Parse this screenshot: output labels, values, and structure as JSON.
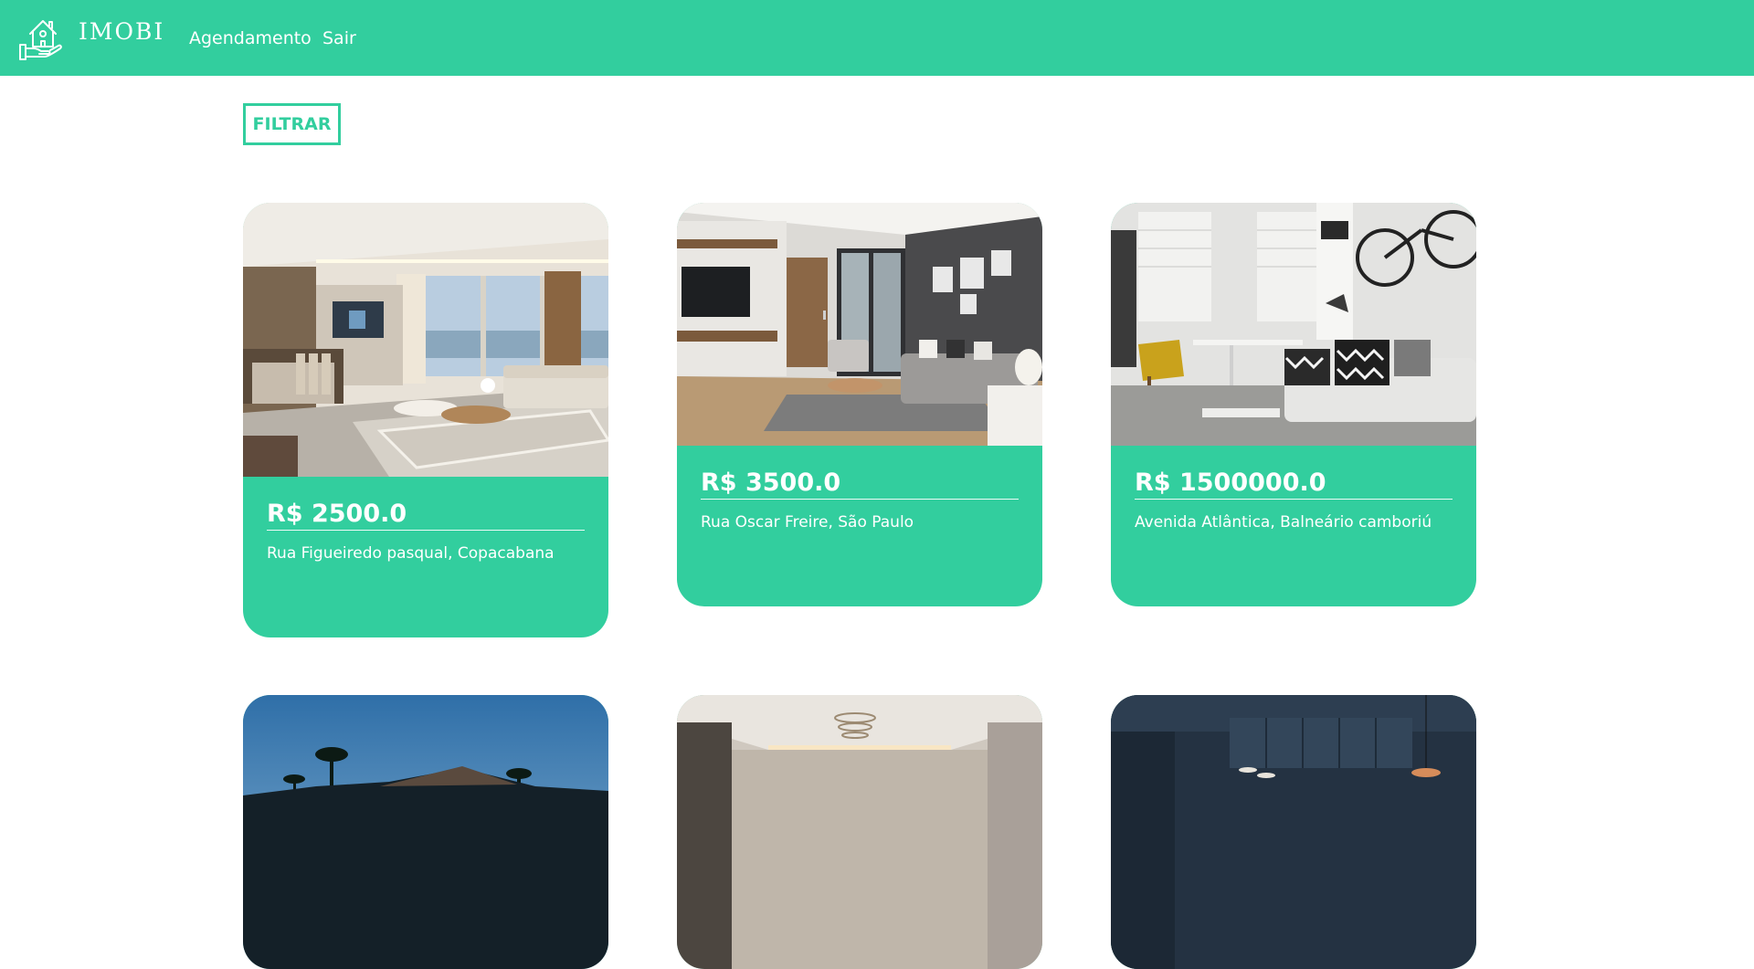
{
  "header": {
    "logo_text": "IMOBI",
    "logo_icon": "house-in-hand-icon",
    "nav": {
      "schedule_label": "Agendamento",
      "logout_label": "Sair"
    }
  },
  "filter": {
    "button_label": "FILTRAR"
  },
  "listings": [
    {
      "price": "R$ 2500.0",
      "address": "Rua Figueiredo pasqual, Copacabana"
    },
    {
      "price": "R$ 3500.0",
      "address": "Rua Oscar Freire, São Paulo"
    },
    {
      "price": "R$ 1500000.0",
      "address": "Avenida Atlântica, Balneário camboriú"
    },
    {
      "price": "",
      "address": ""
    },
    {
      "price": "",
      "address": ""
    },
    {
      "price": "",
      "address": ""
    }
  ],
  "colors": {
    "accent": "#32ce9e",
    "text_on_accent": "#ffffff",
    "background": "#ffffff"
  }
}
